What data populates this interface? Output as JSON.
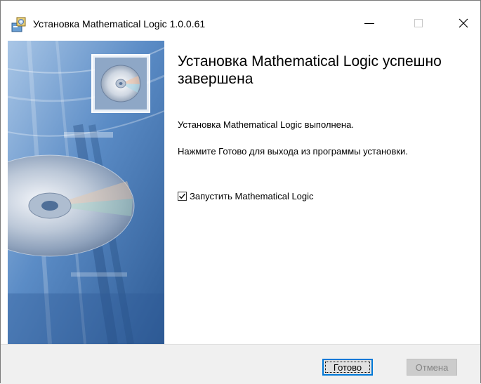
{
  "window": {
    "title": "Установка Mathematical Logic 1.0.0.61"
  },
  "content": {
    "heading": "Установка Mathematical Logic успешно завершена",
    "message": "Установка Mathematical Logic выполнена.",
    "instruction": "Нажмите Готово для выхода из программы установки.",
    "run_checkbox_label": "Запустить Mathematical Logic",
    "run_checkbox_checked": true
  },
  "buttons": {
    "finish_label": "Готово",
    "cancel_label": "Отмена"
  },
  "colors": {
    "panel_blue": "#3d6fa8",
    "focus_border": "#0078d7",
    "footer_bg": "#f0f0f0"
  }
}
